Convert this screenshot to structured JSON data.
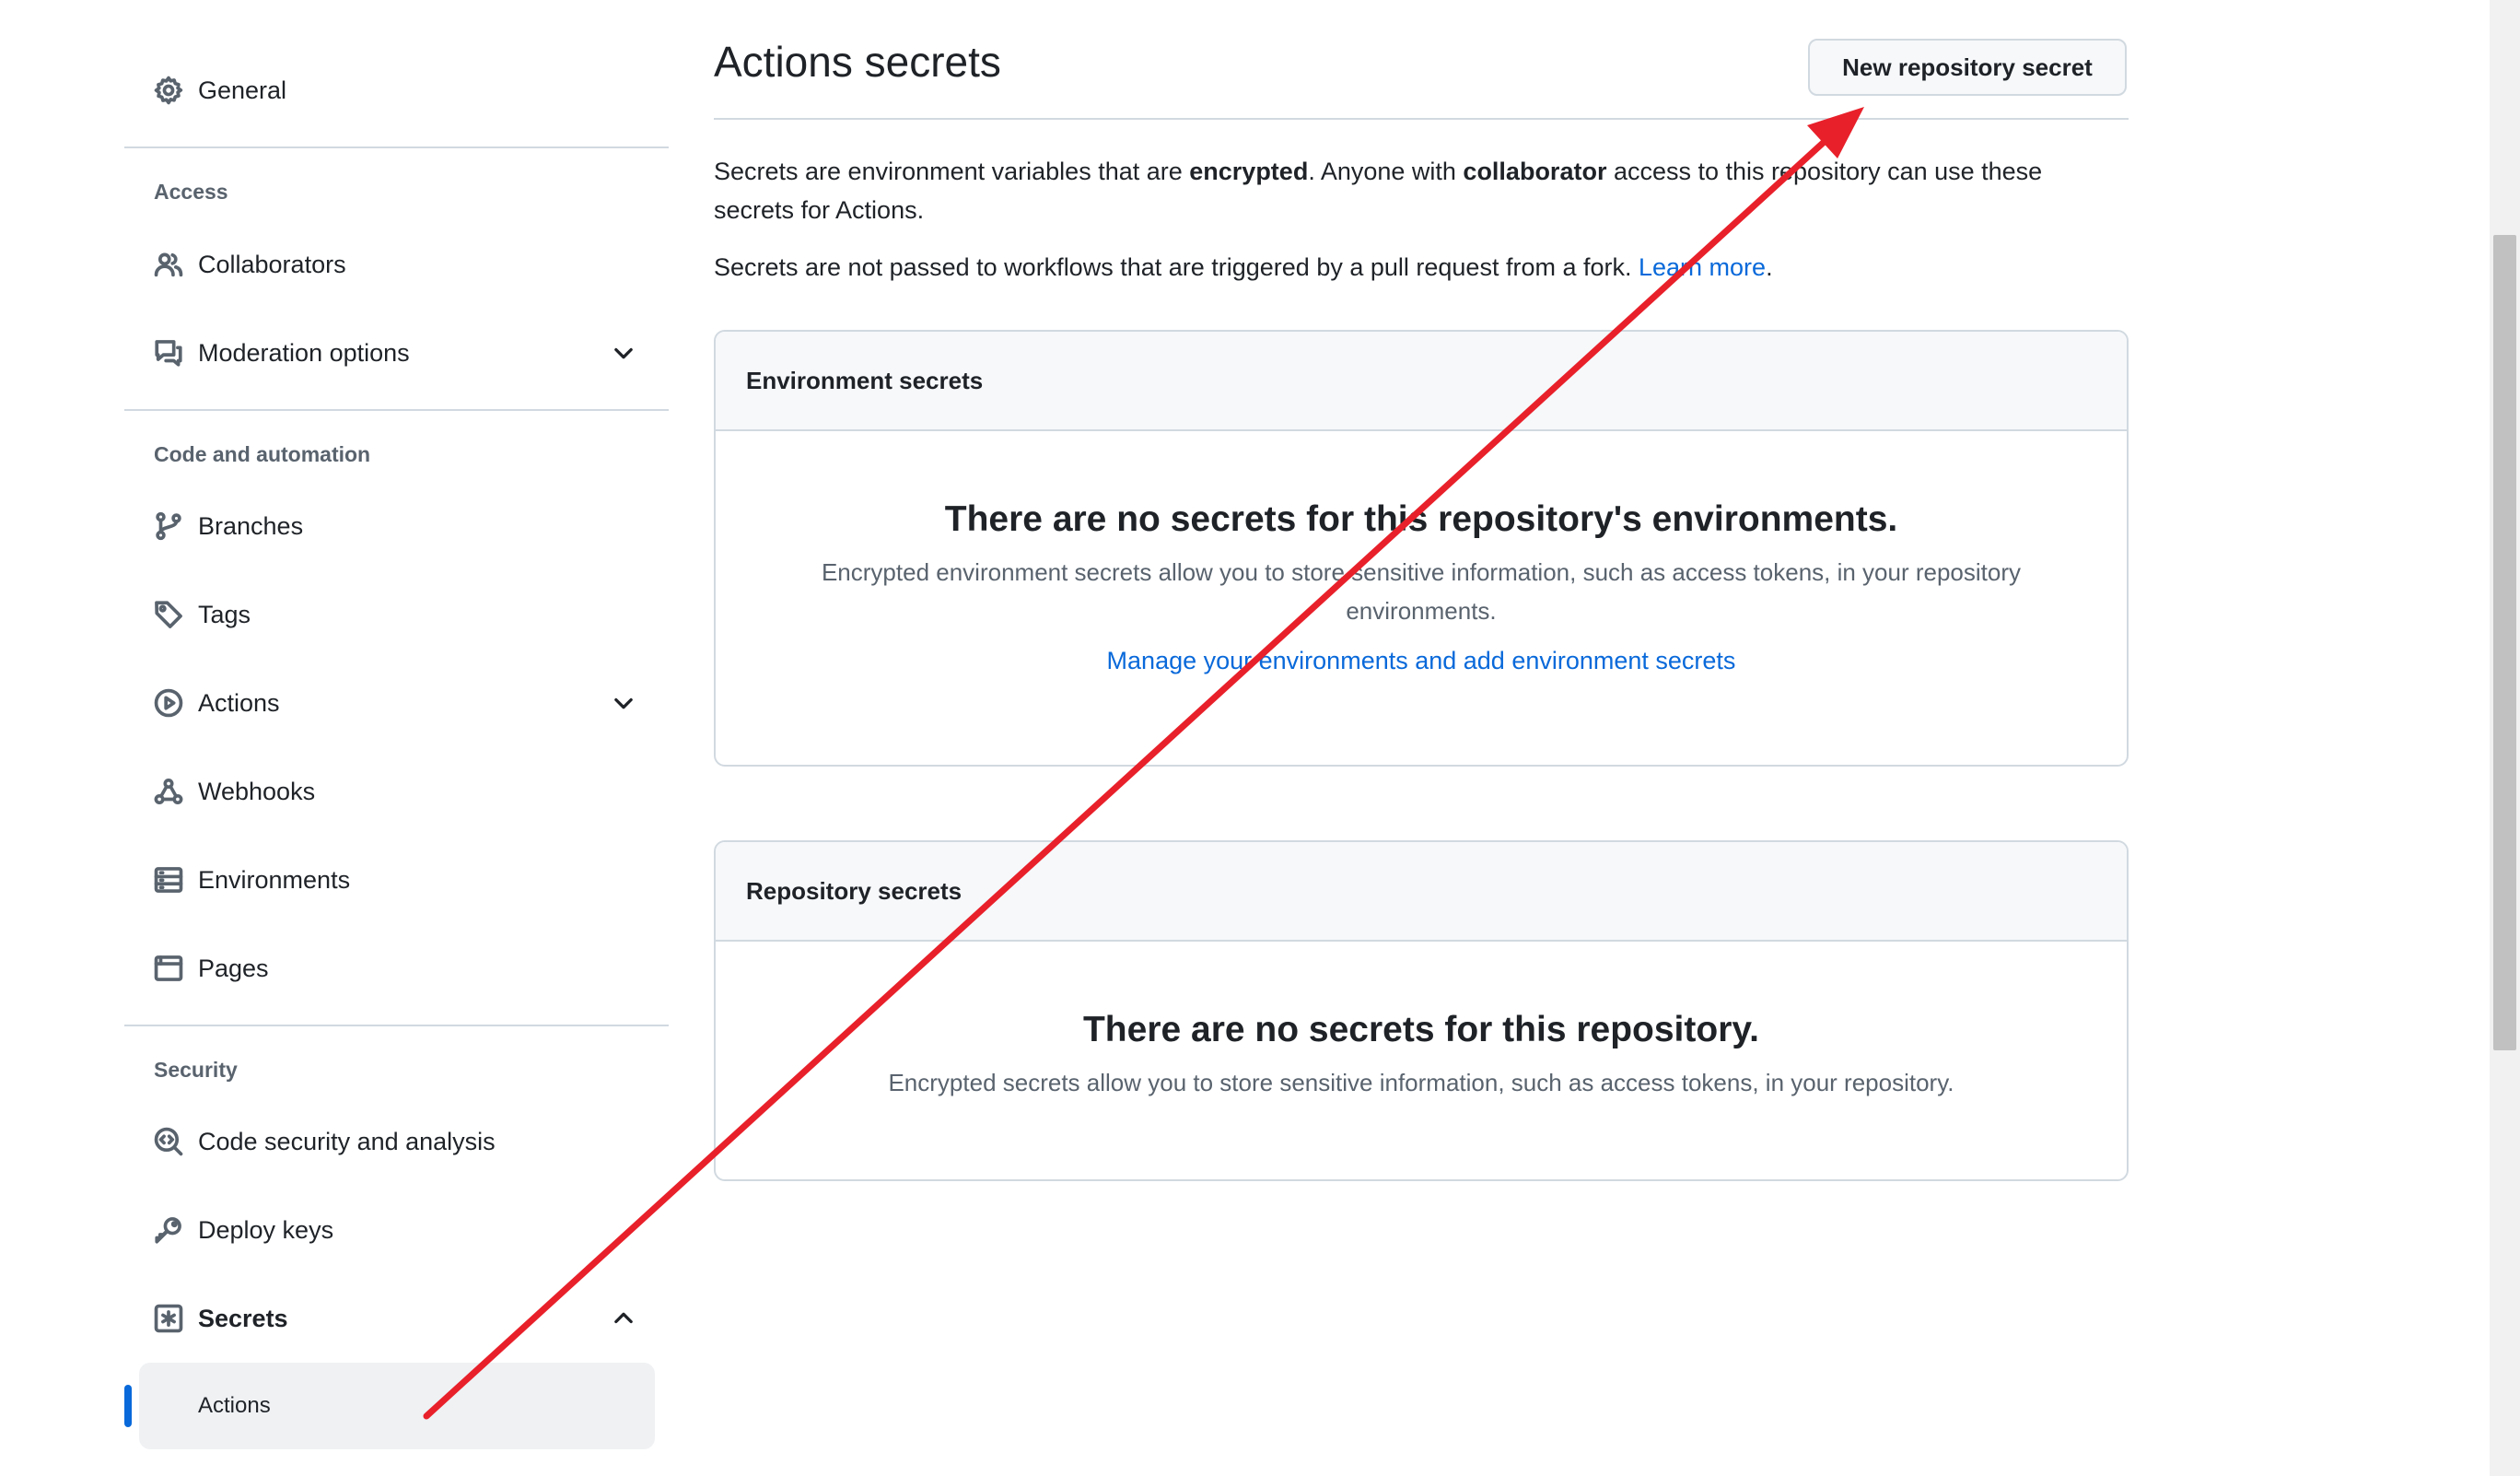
{
  "sidebar": {
    "general": "General",
    "access_header": "Access",
    "collaborators": "Collaborators",
    "moderation": "Moderation options",
    "code_header": "Code and automation",
    "branches": "Branches",
    "tags": "Tags",
    "actions": "Actions",
    "webhooks": "Webhooks",
    "environments": "Environments",
    "pages": "Pages",
    "security_header": "Security",
    "code_security": "Code security and analysis",
    "deploy_keys": "Deploy keys",
    "secrets": "Secrets",
    "secrets_actions": "Actions"
  },
  "main": {
    "title": "Actions secrets",
    "new_button": "New repository secret",
    "intro_a": "Secrets are environment variables that are ",
    "intro_b": "encrypted",
    "intro_c": ". Anyone with ",
    "intro_d": "collaborator",
    "intro_e": " access to this repository can use these secrets for Actions.",
    "note": "Secrets are not passed to workflows that are triggered by a pull request from a fork. ",
    "learn_more": "Learn more",
    "note_end": ".",
    "env_box": {
      "header": "Environment secrets",
      "blank_title": "There are no secrets for this repository's environments.",
      "blank_desc": "Encrypted environment secrets allow you to store sensitive information, such as access tokens, in your repository environments.",
      "link": "Manage your environments and add environment secrets"
    },
    "repo_box": {
      "header": "Repository secrets",
      "blank_title": "There are no secrets for this repository.",
      "blank_desc": "Encrypted secrets allow you to store sensitive information, such as access tokens, in your repository."
    }
  },
  "colors": {
    "accent": "#0969da",
    "annotation_arrow": "#e8202a",
    "active_indicator": "#0969da"
  }
}
